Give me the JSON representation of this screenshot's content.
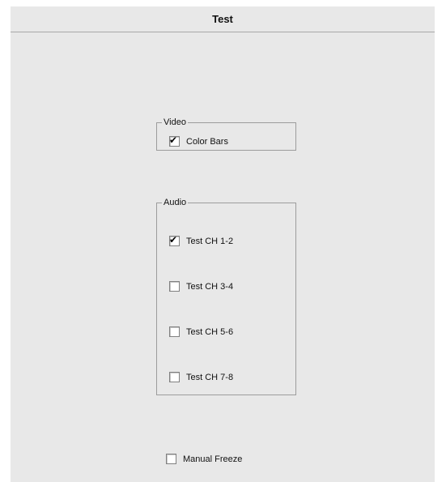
{
  "window": {
    "title": "Test"
  },
  "video": {
    "legend": "Video",
    "items": [
      {
        "label": "Color Bars",
        "checked": true
      }
    ]
  },
  "audio": {
    "legend": "Audio",
    "items": [
      {
        "label": "Test CH 1-2",
        "checked": true
      },
      {
        "label": "Test CH 3-4",
        "checked": false
      },
      {
        "label": "Test CH 5-6",
        "checked": false
      },
      {
        "label": "Test CH 7-8",
        "checked": false
      }
    ]
  },
  "manual_freeze": {
    "label": "Manual Freeze",
    "checked": false
  },
  "icons": {
    "check_mark": "✔"
  }
}
